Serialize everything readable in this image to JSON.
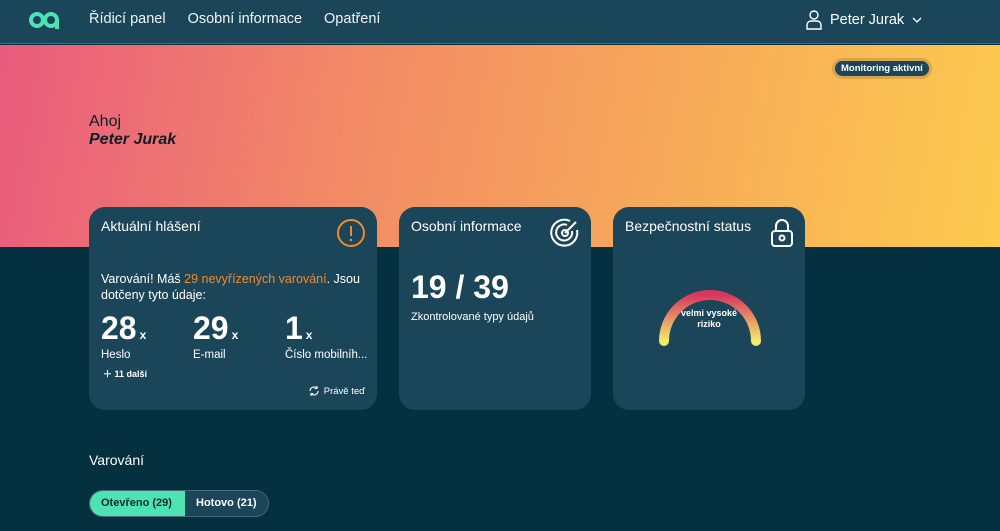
{
  "header": {
    "nav": [
      "Řídicí panel",
      "Osobní informace",
      "Opatření"
    ],
    "user_name": "Peter Jurak"
  },
  "hero": {
    "badge": "Monitoring aktivní",
    "greeting": "Ahoj",
    "name": "Peter Jurak"
  },
  "card_alerts": {
    "title": "Aktuální hlášení",
    "warning_prefix": "Varování! Máš ",
    "warning_highlight": "29 nevyřízených varování",
    "warning_suffix": ". Jsou dotčeny tyto údaje:",
    "stats": [
      {
        "value": "28",
        "suffix": "x",
        "label": "Heslo"
      },
      {
        "value": "29",
        "suffix": "x",
        "label": "E-mail"
      },
      {
        "value": "1",
        "suffix": "x",
        "label": "Číslo mobilníh..."
      }
    ],
    "more": "11 další",
    "updated": "Právě teď"
  },
  "card_personal": {
    "title": "Osobní informace",
    "value": "19 / 39",
    "caption": "Zkontrolované typy údajů"
  },
  "card_security": {
    "title": "Bezpečnostní status",
    "status_line1": "velmi vysoké",
    "status_line2": "riziko"
  },
  "warnings": {
    "title": "Varování",
    "tabs": [
      "Otevřeno (29)",
      "Hotovo (21)"
    ]
  },
  "colors": {
    "accent": "#4ee3b2",
    "warning": "#f18a2b",
    "panel": "#1b4659",
    "background": "#05303f"
  }
}
